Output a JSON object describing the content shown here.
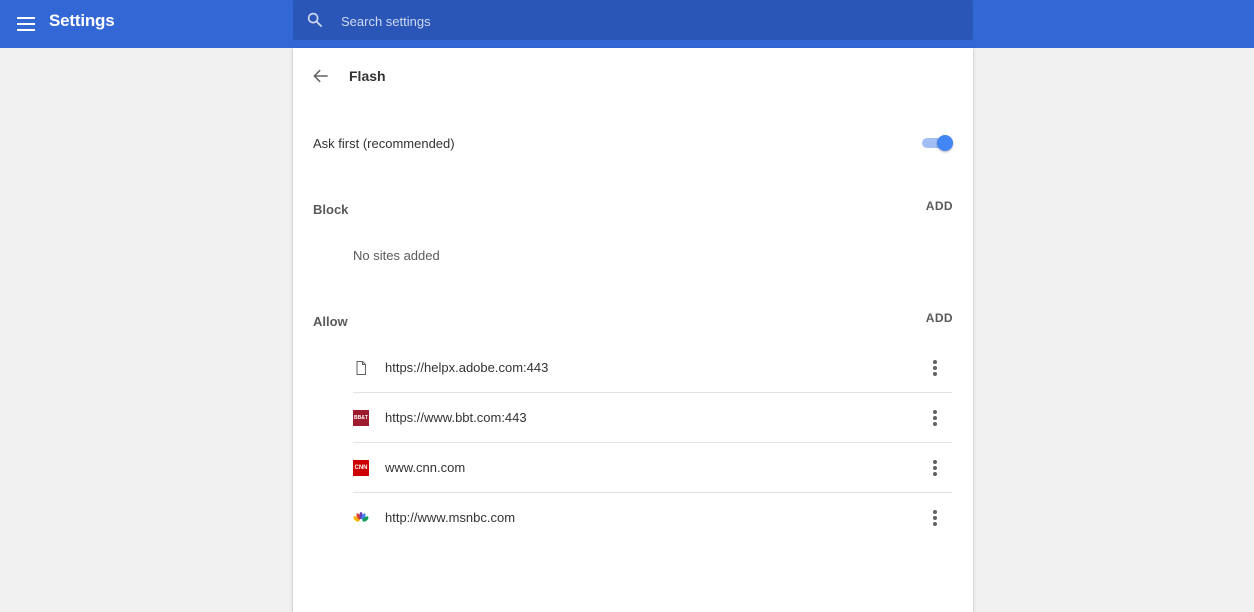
{
  "header": {
    "title": "Settings",
    "search_placeholder": "Search settings",
    "bar_color": "#3367d6"
  },
  "page": {
    "title": "Flash",
    "toggle_label": "Ask first (recommended)",
    "toggle_on": true,
    "accent": "#4285f4"
  },
  "block": {
    "heading": "Block",
    "add_label": "ADD",
    "empty_text": "No sites added"
  },
  "allow": {
    "heading": "Allow",
    "add_label": "ADD",
    "sites": [
      {
        "url": "https://helpx.adobe.com:443",
        "icon": "document-icon"
      },
      {
        "url": "https://www.bbt.com:443",
        "icon": "bbt-favicon-icon",
        "icon_text": "BB&T"
      },
      {
        "url": "www.cnn.com",
        "icon": "cnn-favicon-icon",
        "icon_text": "CNN"
      },
      {
        "url": "http://www.msnbc.com",
        "icon": "nbc-peacock-icon"
      }
    ]
  }
}
